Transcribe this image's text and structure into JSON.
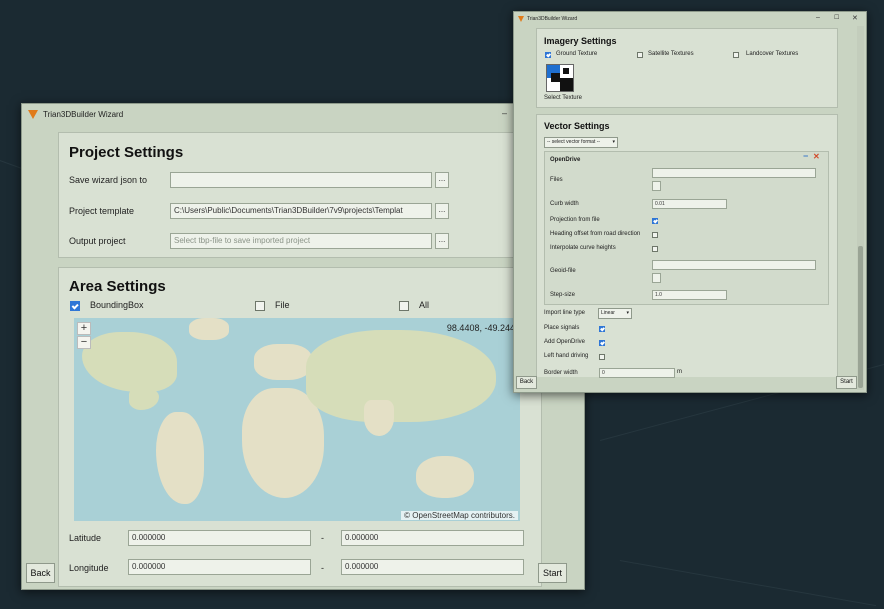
{
  "back_window": {
    "title": "Trian3DBuilder Wizard",
    "project_settings": {
      "heading": "Project Settings",
      "save_wizard_label": "Save wizard json to",
      "save_wizard_value": "",
      "project_template_label": "Project template",
      "project_template_value": "C:\\Users\\Public\\Documents\\Trian3DBuilder\\7v9\\projects\\Templat",
      "output_project_label": "Output project",
      "output_project_placeholder": "Select tbp-file to save imported project",
      "browse_label": "..."
    },
    "area_settings": {
      "heading": "Area Settings",
      "bounding_box_label": "BoundingBox",
      "file_label": "File",
      "all_label": "All",
      "coordinates": "98.4408, -49.2449",
      "attribution": "© OpenStreetMap contributors.",
      "zoom_in": "+",
      "zoom_out": "−",
      "latitude_label": "Latitude",
      "latitude_min": "0.000000",
      "latitude_max": "0.000000",
      "longitude_label": "Longitude",
      "longitude_min": "0.000000",
      "longitude_max": "0.000000",
      "range_sep": "-"
    },
    "back_label": "Back",
    "start_label": "Start",
    "window_minimize": "–"
  },
  "front_window": {
    "title": "Trian3DBuilder Wizard",
    "controls": {
      "minimize": "–",
      "maximize": "☐",
      "close": "✕"
    },
    "imagery_settings": {
      "heading": "Imagery Settings",
      "ground_texture_label": "Ground Texture",
      "satellite_textures_label": "Satellite Textures",
      "landcover_textures_label": "Landcover Textures",
      "select_texture_label": "Select Texture"
    },
    "vector_settings": {
      "heading": "Vector Settings",
      "format_select": "-- select vector format --",
      "opendrive": {
        "heading": "OpenDrive",
        "files_label": "Files",
        "curb_width_label": "Curb width",
        "curb_width_value": "0.01",
        "projection_label": "Projection from file",
        "heading_offset_label": "Heading offset from road direction",
        "interpolate_label": "Interpolate curve heights",
        "geoid_label": "Geoid-file",
        "step_size_label": "Step-size",
        "step_size_value": "1.0",
        "remove": "−",
        "close": "✕"
      },
      "import_line_type_label": "Import line type",
      "import_line_type_value": "Linear",
      "place_signals_label": "Place signals",
      "add_opendrive_label": "Add OpenDrive",
      "left_hand_label": "Left hand driving",
      "border_width_label": "Border width",
      "border_width_value": "0",
      "border_width_unit": "m"
    },
    "back_label": "Back",
    "start_label": "Start"
  }
}
